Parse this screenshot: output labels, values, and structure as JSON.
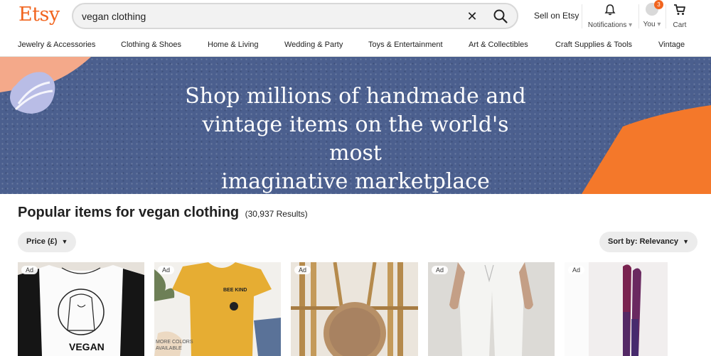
{
  "header": {
    "logo": "Etsy",
    "search_value": "vegan clothing",
    "sell_label": "Sell on Etsy",
    "notifications_label": "Notifications",
    "you_label": "You",
    "you_badge": "3",
    "cart_label": "Cart",
    "accent_color": "#f1641e"
  },
  "nav": {
    "categories": [
      "Jewelry & Accessories",
      "Clothing & Shoes",
      "Home & Living",
      "Wedding & Party",
      "Toys & Entertainment",
      "Art & Collectibles",
      "Craft Supplies & Tools",
      "Vintage"
    ]
  },
  "hero": {
    "line1": "Shop millions of handmade and",
    "line2": "vintage items on the world's most",
    "line3": "imaginative marketplace",
    "background_color": "#4b5f8e"
  },
  "results": {
    "heading": "Popular items for vegan clothing",
    "count": "(30,937 Results)",
    "price_filter": "Price (£)",
    "sort_label": "Sort by: Relevancy"
  },
  "products": [
    {
      "ad": "Ad",
      "image_text": "VEGAN",
      "subject": "vegan-raglan-tee"
    },
    {
      "ad": "Ad",
      "image_text": "BEE KIND",
      "subject": "bee-kind-tee",
      "badge_line1": "MORE COLORS",
      "badge_line2": "AVAILABLE"
    },
    {
      "ad": "Ad",
      "subject": "round-rattan-bag"
    },
    {
      "ad": "Ad",
      "subject": "white-trousers"
    },
    {
      "ad": "Ad",
      "subject": "purple-tights"
    }
  ]
}
